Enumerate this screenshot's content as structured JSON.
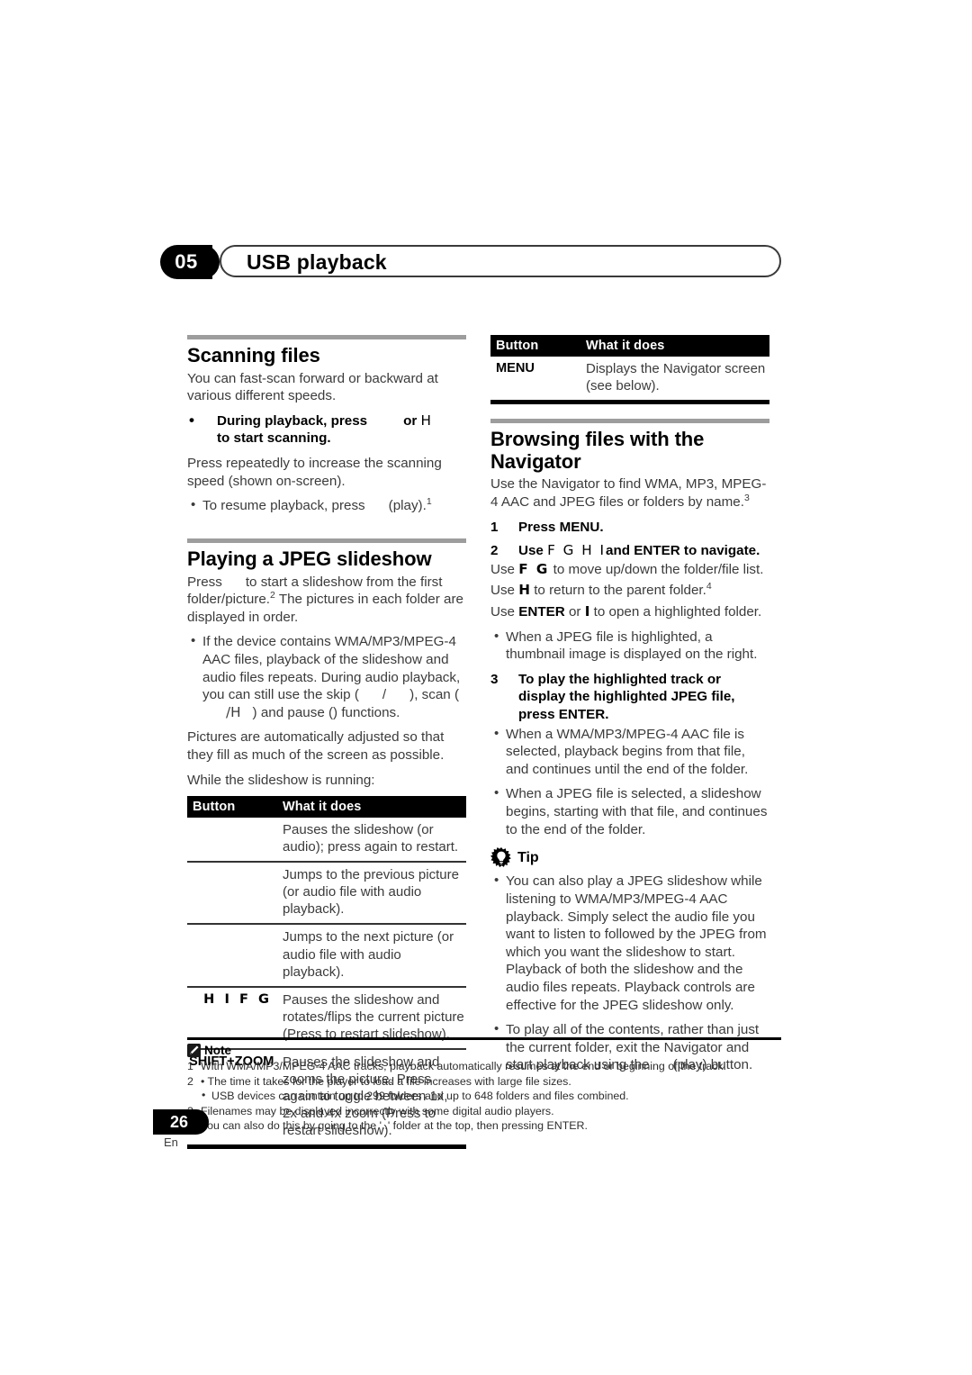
{
  "header": {
    "chapter_number": "05",
    "chapter_title": "USB playback"
  },
  "left_column": {
    "scanning": {
      "heading": "Scanning files",
      "intro": "You can fast-scan forward or backward at various different speeds.",
      "instruction_bold_pre": "During playback, press",
      "instruction_bold_or": "or",
      "instruction_bold_key": "H",
      "instruction_bold_post": "to start scanning.",
      "body": "Press repeatedly to increase the scanning speed (shown on-screen).",
      "bullet": "To resume playback, press",
      "bullet_tail": "(play).",
      "bullet_footnote": "1"
    },
    "slideshow": {
      "heading": "Playing a JPEG slideshow",
      "intro_pre": "Press",
      "intro_mid": "to start a slideshow from the first folder/picture.",
      "intro_footnote": "2",
      "intro_post": "The pictures in each folder are displayed in order.",
      "bullet_1_a": "If the device contains WMA/MP3/MPEG-4 AAC files, playback of the slideshow and audio files repeats. During audio playback, you can still use the skip (",
      "bullet_1_sep": "/",
      "bullet_1_b": "), scan (",
      "bullet_1_key": "/H",
      "bullet_1_c": ") and pause (",
      "bullet_1_d": ") functions.",
      "para_fit": "Pictures are automatically adjusted so that they fill as much of the screen as possible.",
      "para_while": "While the slideshow is running:"
    },
    "table": {
      "headers": [
        "Button",
        "What it does"
      ],
      "rows": [
        {
          "button": "",
          "what": "Pauses the slideshow (or audio); press again to restart."
        },
        {
          "button": "",
          "what": "Jumps to the previous picture (or audio file with audio playback)."
        },
        {
          "button": "",
          "what": "Jumps to the next picture (or audio file with audio playback)."
        },
        {
          "button": "H I F G",
          "what": "Pauses the slideshow and rotates/flips the current picture (Press    to restart slideshow)."
        },
        {
          "button": "SHIFT+ZOOM",
          "what": "Pauses the slideshow and zooms the picture. Press again to toggle between 1x, 2x and 4x zoom (Press    to restart slideshow)."
        }
      ]
    }
  },
  "right_column": {
    "table": {
      "headers": [
        "Button",
        "What it does"
      ],
      "rows": [
        {
          "button": "MENU",
          "what": "Displays the Navigator screen (see below)."
        }
      ]
    },
    "navigator": {
      "heading": "Browsing files with the Navigator",
      "intro_pre": "Use the Navigator to find WMA, MP3, MPEG-4 AAC and JPEG files or folders by name.",
      "intro_footnote": "3",
      "step_1_num": "1",
      "step_1_text": "Press MENU.",
      "step_2_num": "2",
      "step_2_pre": "Use",
      "step_2_keys": "F  G  H   I",
      "step_2_post": "and ENTER to navigate.",
      "line_updown_pre": "Use",
      "line_updown_keys": "F  G",
      "line_updown_post": "to move up/down the folder/file list.",
      "line_parent_pre": "Use",
      "line_parent_key": "H",
      "line_parent_post": "to return to the parent folder.",
      "line_parent_footnote": "4",
      "line_open_pre": "Use",
      "line_open_enter": "ENTER",
      "line_open_or": "or",
      "line_open_key": "I",
      "line_open_post": "to open a highlighted folder.",
      "bullet_thumb": "When a JPEG file is highlighted, a thumbnail image is displayed on the right.",
      "step_3_num": "3",
      "step_3_text": "To play the highlighted track or display the highlighted JPEG file, press ENTER.",
      "bullet_wma": "When a WMA/MP3/MPEG-4 AAC file is selected, playback begins from that file, and continues until the end of the folder.",
      "bullet_jpeg": "When a JPEG file is selected, a slideshow begins, starting with that file, and continues to the end of the folder."
    },
    "tip": {
      "label": "Tip",
      "icon": "lightbulb-icon",
      "bullet_1": "You can also play a JPEG slideshow while listening to WMA/MP3/MPEG-4 AAC playback. Simply select the audio file you want to listen to followed by the JPEG from which you want the slideshow to start. Playback of both the slideshow and the audio files repeats. Playback controls are effective for the JPEG slideshow only.",
      "bullet_2_pre": "To play all of the contents, rather than just the current folder, exit the Navigator and start playback using the",
      "bullet_2_post": "(play) button."
    }
  },
  "notes": {
    "label": "Note",
    "icon": "pencil-icon",
    "items": [
      {
        "num": "1",
        "text": "With WMA/MP3/MPEG-4 AAC tracks, playback automatically resumes at the end or beginning of the track.",
        "sub": false
      },
      {
        "num": "2",
        "text": "• The time it takes for the player to load a file increases with large file sizes.",
        "sub": false
      },
      {
        "num": "",
        "text": "USB devices can contain up to 299 folders and up to 648 folders and files combined.",
        "sub": true
      },
      {
        "num": "3",
        "text": "Filenames may be displayed incorrectly with some digital audio players.",
        "sub": false
      },
      {
        "num": "4",
        "text": "You can also do this by going to the '..' folder at the top, then pressing ENTER.",
        "sub": false
      }
    ]
  },
  "footer": {
    "page_number": "26",
    "language": "En"
  }
}
